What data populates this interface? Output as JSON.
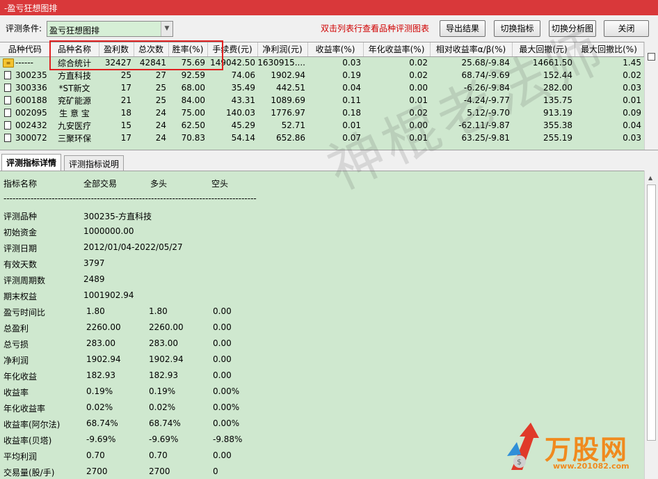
{
  "window": {
    "title": "-盈亏狂想图排"
  },
  "toolbar": {
    "condition_label": "评测条件:",
    "condition_value": "盈亏狂想图排",
    "hint": "双击列表行查看品种评测图表",
    "buttons": [
      "导出结果",
      "切换指标",
      "切换分析图",
      "关闭"
    ]
  },
  "grid": {
    "columns": [
      "品种代码",
      "品种名称",
      "盈利数",
      "总次数",
      "胜率(%)",
      "手续费(元)",
      "净利润(元)",
      "收益率(%)",
      "年化收益率(%)",
      "相对收益率α/β(%)",
      "最大回撤(元)",
      "最大回撤比(%)"
    ],
    "summary": [
      "------",
      "综合统计",
      "32427",
      "42841",
      "75.69",
      "149042.50",
      "1630915....",
      "0.03",
      "0.02",
      "25.68/-9.84",
      "14661.50",
      "1.45"
    ],
    "rows": [
      [
        "300235",
        "方直科技",
        "25",
        "27",
        "92.59",
        "74.06",
        "1902.94",
        "0.19",
        "0.02",
        "68.74/-9.69",
        "152.44",
        "0.02"
      ],
      [
        "300336",
        "*ST新文",
        "17",
        "25",
        "68.00",
        "35.49",
        "442.51",
        "0.04",
        "0.00",
        "-6.26/-9.84",
        "282.00",
        "0.03"
      ],
      [
        "600188",
        "兖矿能源",
        "21",
        "25",
        "84.00",
        "43.31",
        "1089.69",
        "0.11",
        "0.01",
        "-4.24/-9.77",
        "135.75",
        "0.01"
      ],
      [
        "002095",
        "生 意 宝",
        "18",
        "24",
        "75.00",
        "140.03",
        "1776.97",
        "0.18",
        "0.02",
        "5.12/-9.70",
        "913.19",
        "0.09"
      ],
      [
        "002432",
        "九安医疗",
        "15",
        "24",
        "62.50",
        "45.29",
        "52.71",
        "0.01",
        "0.00",
        "-62.11/-9.87",
        "355.38",
        "0.04"
      ],
      [
        "300072",
        "三聚环保",
        "17",
        "24",
        "70.83",
        "54.14",
        "652.86",
        "0.07",
        "0.01",
        "63.25/-9.81",
        "255.19",
        "0.03"
      ]
    ]
  },
  "tabs": [
    "评测指标详情",
    "评测指标说明"
  ],
  "detail": {
    "headers": [
      "指标名称",
      "全部交易",
      "多头",
      "空头"
    ],
    "separator": "--------------------------------------------------------------------------------------",
    "info": [
      {
        "label": "评测品种",
        "value": "300235-方直科技"
      },
      {
        "label": "初始资金",
        "value": "1000000.00"
      },
      {
        "label": "评测日期",
        "value": "2012/01/04-2022/05/27"
      },
      {
        "label": "有效天数",
        "value": "3797"
      },
      {
        "label": "评测周期数",
        "value": "2489"
      },
      {
        "label": "期末权益",
        "value": "1001902.94"
      }
    ],
    "metrics": [
      {
        "label": "盈亏时间比",
        "all": "1.80",
        "long": "1.80",
        "short": "0.00"
      },
      {
        "label": "总盈利",
        "all": "2260.00",
        "long": "2260.00",
        "short": "0.00"
      },
      {
        "label": "总亏损",
        "all": "283.00",
        "long": "283.00",
        "short": "0.00"
      },
      {
        "label": "净利润",
        "all": "1902.94",
        "long": "1902.94",
        "short": "0.00"
      },
      {
        "label": "年化收益",
        "all": "182.93",
        "long": "182.93",
        "short": "0.00"
      },
      {
        "label": "收益率",
        "all": "0.19%",
        "long": "0.19%",
        "short": "0.00%"
      },
      {
        "label": "年化收益率",
        "all": "0.02%",
        "long": "0.02%",
        "short": "0.00%"
      },
      {
        "label": "收益率(阿尔法)",
        "all": "68.74%",
        "long": "68.74%",
        "short": "0.00%"
      },
      {
        "label": "收益率(贝塔)",
        "all": "-9.69%",
        "long": "-9.69%",
        "short": "-9.88%"
      },
      {
        "label": "平均利润",
        "all": "0.70",
        "long": "0.70",
        "short": "0.00"
      },
      {
        "label": "交易量(股/手)",
        "all": "2700",
        "long": "2700",
        "short": "0"
      }
    ]
  },
  "watermark": "神棍老法师",
  "brand": {
    "name": "万股网",
    "url": "www.201082.com"
  },
  "colors": {
    "title_bg": "#d9383a",
    "grid_bg": "#cfe8cf",
    "highlight": "#e02020",
    "hint": "#d00000",
    "brand": "#f08a1e"
  }
}
